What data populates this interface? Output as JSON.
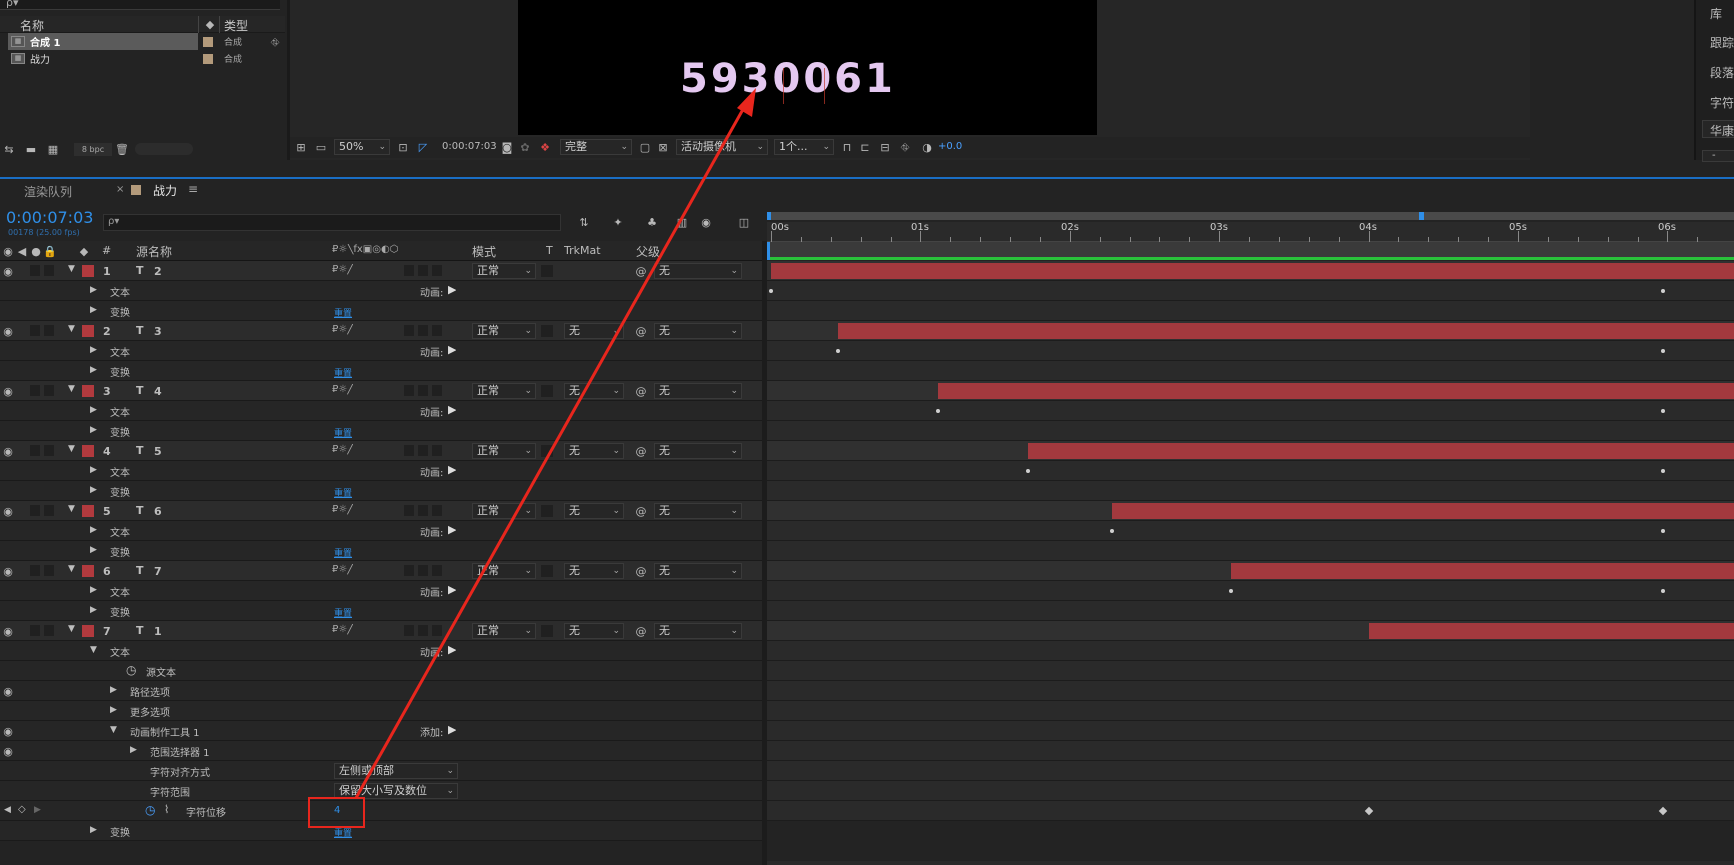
{
  "project": {
    "col_name": "名称",
    "col_type": "类型",
    "items": [
      {
        "name": "合成 1",
        "type": "合成"
      },
      {
        "name": "战力",
        "type": "合成"
      }
    ],
    "bpc": "8 bpc"
  },
  "viewer": {
    "number_text": "5930061",
    "zoom": "50%",
    "timecode": "0:00:07:03",
    "resolution": "完整",
    "camera": "活动摄像机",
    "views": "1个...",
    "exposure": "+0.0"
  },
  "right_panel": {
    "items": [
      "库",
      "跟踪",
      "段落",
      "字符",
      "华康"
    ],
    "dash": "-"
  },
  "tabs": {
    "render_queue": "渲染队列",
    "comp": "战力"
  },
  "timeline": {
    "timecode": "0:00:07:03",
    "frames": "00178 (25.00 fps)",
    "search_placeholder": "ρ▾",
    "headers": {
      "num": "#",
      "source": "源名称",
      "mode": "模式",
      "t": "T",
      "trkmat": "TrkMat",
      "parent": "父级"
    },
    "ruler": [
      "00s",
      "01s",
      "02s",
      "03s",
      "04s",
      "05s",
      "06s"
    ],
    "layers": [
      {
        "num": "1",
        "name": "2",
        "mode": "正常",
        "trkmat": "",
        "parent": "无",
        "text": "文本",
        "transform": "变换",
        "animate": "动画:",
        "reset": "重置",
        "start": 0.0
      },
      {
        "num": "2",
        "name": "3",
        "mode": "正常",
        "trkmat": "无",
        "parent": "无",
        "text": "文本",
        "transform": "变换",
        "animate": "动画:",
        "reset": "重置",
        "start": 0.45
      },
      {
        "num": "3",
        "name": "4",
        "mode": "正常",
        "trkmat": "无",
        "parent": "无",
        "text": "文本",
        "transform": "变换",
        "animate": "动画:",
        "reset": "重置",
        "start": 1.12
      },
      {
        "num": "4",
        "name": "5",
        "mode": "正常",
        "trkmat": "无",
        "parent": "无",
        "text": "文本",
        "transform": "变换",
        "animate": "动画:",
        "reset": "重置",
        "start": 1.72
      },
      {
        "num": "5",
        "name": "6",
        "mode": "正常",
        "trkmat": "无",
        "parent": "无",
        "text": "文本",
        "transform": "变换",
        "animate": "动画:",
        "reset": "重置",
        "start": 2.28
      },
      {
        "num": "6",
        "name": "7",
        "mode": "正常",
        "trkmat": "无",
        "parent": "无",
        "text": "文本",
        "transform": "变换",
        "animate": "动画:",
        "reset": "重置",
        "start": 3.08
      }
    ],
    "layer7": {
      "num": "7",
      "name": "1",
      "mode": "正常",
      "trkmat": "无",
      "parent": "无",
      "start": 4.0,
      "text": "文本",
      "animate": "动画:",
      "source_text": "源文本",
      "path_options": "路径选项",
      "more_options": "更多选项",
      "animator": "动画制作工具 1",
      "add": "添加:",
      "range_selector": "范围选择器 1",
      "char_align": "字符对齐方式",
      "char_align_value": "左侧或顶部",
      "char_range": "字符范围",
      "char_range_value": "保留大小写及数位",
      "char_offset": "字符位移",
      "char_offset_value": "4",
      "transform": "变换",
      "reset": "重置"
    }
  }
}
